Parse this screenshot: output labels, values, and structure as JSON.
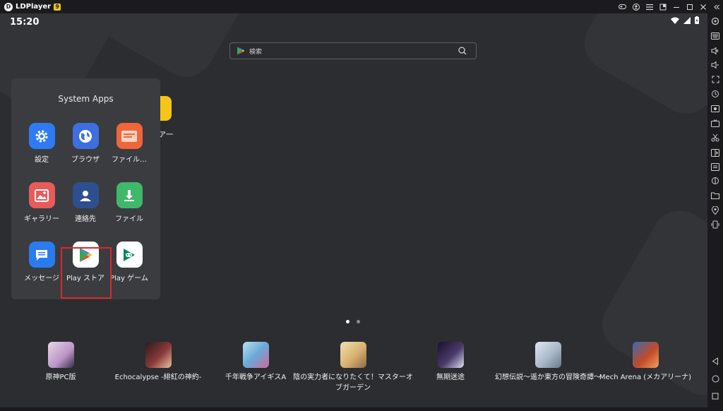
{
  "titlebar": {
    "app_name": "LDPlayer",
    "version_badge": "9",
    "controls": [
      "gamepad-icon",
      "account-icon",
      "menu-icon",
      "restore-icon",
      "minimize-icon",
      "maximize-icon",
      "close-icon",
      "collapse-icon"
    ]
  },
  "status_bar": {
    "time": "15:20"
  },
  "search": {
    "placeholder": "検索"
  },
  "peek_app": {
    "label": "ア一"
  },
  "folder": {
    "title": "System Apps",
    "apps": [
      {
        "label": "設定",
        "icon": "settings-icon",
        "color": "#2f7bf5"
      },
      {
        "label": "ブラウザ",
        "icon": "browser-icon",
        "color": "#3d6fe0"
      },
      {
        "label": "ファイル…",
        "icon": "files-icon",
        "color": "#f0653a"
      },
      {
        "label": "ギャラリー",
        "icon": "gallery-icon",
        "color": "#e85b5b"
      },
      {
        "label": "連絡先",
        "icon": "contacts-icon",
        "color": "#2e4f8f"
      },
      {
        "label": "ファイル",
        "icon": "download-icon",
        "color": "#3fb86a"
      },
      {
        "label": "メッセージ",
        "icon": "message-icon",
        "color": "#2b7bf0"
      },
      {
        "label": "Play ストア",
        "icon": "play-store-icon",
        "color": "#ffffff"
      },
      {
        "label": "Play ゲーム",
        "icon": "play-games-icon",
        "color": "#ffffff"
      }
    ]
  },
  "dock": {
    "games": [
      {
        "label": "原神PC版",
        "icon": "genshin-icon",
        "color": "#c9a7c6"
      },
      {
        "label": "Echocalypse -緋紅の神約-",
        "icon": "echocalypse-icon",
        "color": "#7a3a3a"
      },
      {
        "label": "千年戦争アイギスA",
        "icon": "aigis-icon",
        "color": "#7bb1d8"
      },
      {
        "label": "陰の実力者になりたくて！マスターオブガーデン",
        "icon": "kage-icon",
        "color": "#d8c090"
      },
      {
        "label": "無期迷途",
        "icon": "mugen-icon",
        "color": "#2a2040"
      },
      {
        "label": "幻想伝説〜遥か東方の冒険奇譚〜",
        "icon": "genso-icon",
        "color": "#a8b8c8"
      },
      {
        "label": "Mech Arena (メカアリーナ)",
        "icon": "mech-arena-icon",
        "color": "#8a3a2a"
      }
    ]
  },
  "sidebar": {
    "buttons": [
      "settings-icon",
      "keyboard-icon",
      "volume-up-icon",
      "volume-down-icon",
      "fullscreen-icon",
      "sync-icon",
      "screenshot-icon",
      "record-icon",
      "scissors-icon",
      "multi-instance-icon",
      "apk-icon",
      "shake-icon",
      "folder-icon",
      "location-icon",
      "rotate-icon",
      "back-icon",
      "home-icon",
      "recents-icon"
    ]
  }
}
